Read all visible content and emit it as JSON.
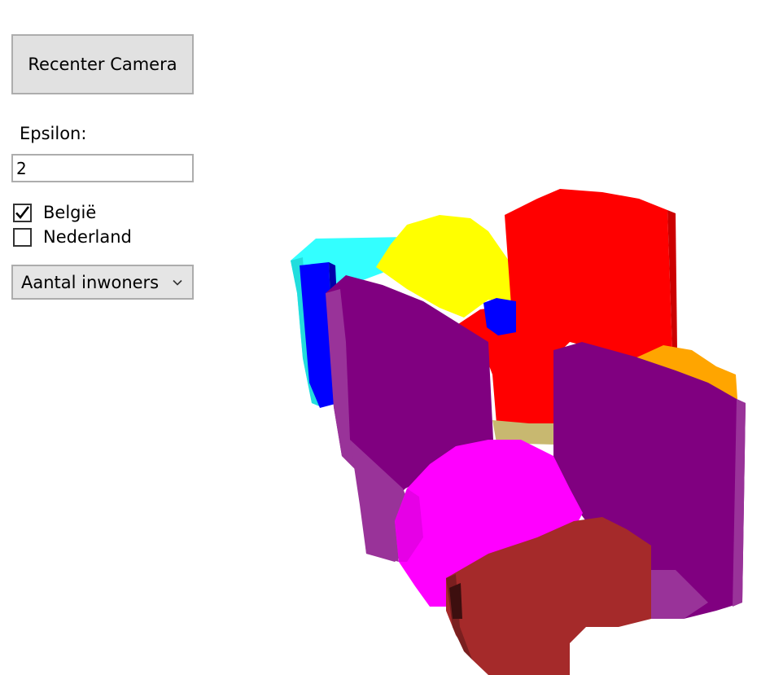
{
  "toolbar": {
    "recenter_label": "Recenter Camera"
  },
  "epsilon": {
    "label": "Epsilon:",
    "value": "2"
  },
  "countries": [
    {
      "label": "België",
      "checked": true
    },
    {
      "label": "Nederland",
      "checked": false
    }
  ],
  "metric_select": {
    "selected": "Aantal inwoners"
  },
  "icons": {
    "check": "checkmark-icon",
    "dropdown": "chevron-down-icon"
  },
  "colors": {
    "cyan": "#33ffff",
    "blue": "#0000ff",
    "yellow": "#ffff00",
    "red": "#ff0000",
    "purple": "#800080",
    "orange": "#ffa500",
    "magenta": "#ff00ff",
    "brown": "#a52a2a",
    "khaki": "#c8b870"
  }
}
